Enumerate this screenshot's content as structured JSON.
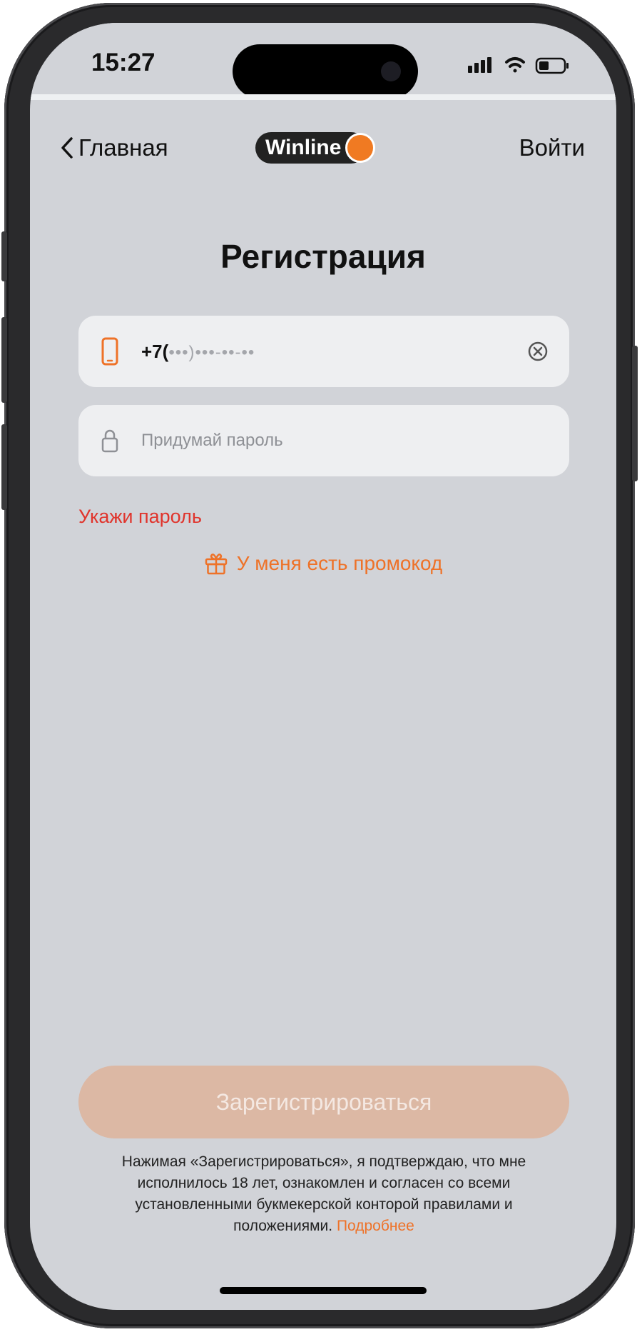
{
  "status_bar": {
    "time": "15:27"
  },
  "navbar": {
    "back_label": "Главная",
    "logo_text": "Winline",
    "login_label": "Войти"
  },
  "page": {
    "title": "Регистрация"
  },
  "form": {
    "phone_prefix": "+7(",
    "phone_mask": "•••)•••-••-••",
    "password_placeholder": "Придумай пароль",
    "error": "Укажи пароль",
    "promo_label": "У меня есть промокод",
    "submit_label": "Зарегистрироваться"
  },
  "disclaimer": {
    "text": "Нажимая «Зарегистрироваться», я подтверждаю, что мне исполнилось 18 лет, ознакомлен и согласен со всеми установленными букмекерской конторой правилами и положениями. ",
    "link": "Подробнее"
  },
  "icons": {
    "back": "chevron-left-icon",
    "phone": "smartphone-icon",
    "lock": "lock-icon",
    "clear": "clear-circle-icon",
    "gift": "gift-icon",
    "signal": "signal-icon",
    "wifi": "wifi-icon",
    "battery": "battery-icon"
  },
  "colors": {
    "accent": "#ee7228",
    "error": "#e0342c",
    "background": "#d1d3d8",
    "field": "#eeeff1",
    "button_disabled": "#dcb8a4"
  }
}
